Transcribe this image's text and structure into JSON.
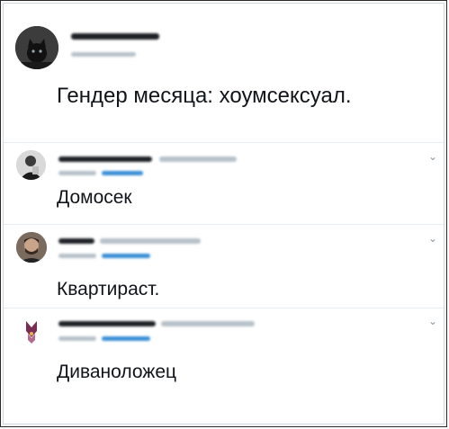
{
  "post": {
    "text": "Гендер месяца: хоумсексуал."
  },
  "replies": [
    {
      "text": "Домосек"
    },
    {
      "text": "Квартираст."
    },
    {
      "text": "Диваноложец"
    }
  ],
  "colors": {
    "name_blur": "#1e2226",
    "meta_blur": "#b7c1ca",
    "link_blur": "#3a8fd6",
    "divider": "#e6ecf0",
    "chevron": "#8899a6"
  },
  "icons": {
    "reply_menu": "chevron-down-icon"
  }
}
